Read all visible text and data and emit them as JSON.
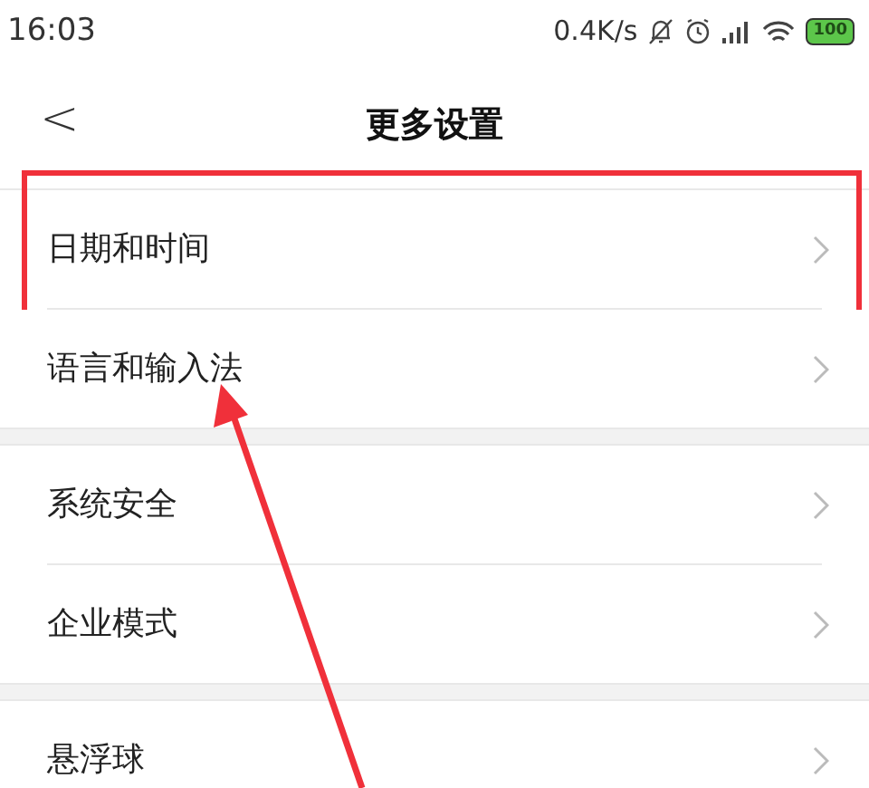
{
  "status_bar": {
    "time": "16:03",
    "speed": "0.4K/s",
    "battery": "100"
  },
  "header": {
    "back": "<",
    "title": "更多设置"
  },
  "groups": [
    {
      "items": [
        {
          "label": "日期和时间",
          "highlighted": true
        },
        {
          "label": "语言和输入法",
          "highlighted": false
        }
      ]
    },
    {
      "items": [
        {
          "label": "系统安全",
          "highlighted": false
        },
        {
          "label": "企业模式",
          "highlighted": false
        }
      ]
    },
    {
      "items": [
        {
          "label": "悬浮球",
          "highlighted": false
        }
      ]
    }
  ]
}
